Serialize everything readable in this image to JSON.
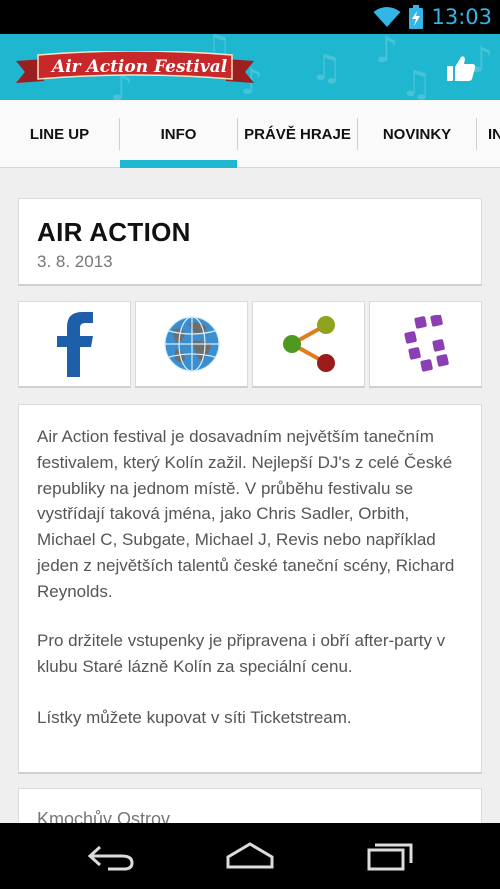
{
  "status_bar": {
    "time": "13:03",
    "icons": [
      "wifi-icon",
      "battery-charging-icon"
    ]
  },
  "app_bar": {
    "logo_text": "Air Action Festival",
    "like_icon": "thumbs-up-icon",
    "background_color": "#1fb6cf",
    "ribbon_color": "#c8282a"
  },
  "tabs": [
    {
      "label": "LINE UP"
    },
    {
      "label": "INFO",
      "selected": true
    },
    {
      "label": "PRÁVĚ HRAJE"
    },
    {
      "label": "NOVINKY"
    },
    {
      "label": "IN"
    }
  ],
  "event": {
    "title": "AIR ACTION",
    "date": "3. 8. 2013"
  },
  "share_buttons": [
    {
      "name": "facebook-icon",
      "color": "#1f5ea8"
    },
    {
      "name": "globe-icon",
      "color": "#3b8fd1"
    },
    {
      "name": "share-icon",
      "colors": [
        "#e07b1e",
        "#4c9a1f",
        "#8fa31e",
        "#9b1b1b"
      ]
    },
    {
      "name": "app-logo-icon",
      "color": "#8a3fb3"
    }
  ],
  "description": {
    "paragraphs": [
      "Air Action festival je dosavadním největším tanečním festivalem, který Kolín zažil. Nejlepší DJ's z celé České republiky na jednom místě. V průběhu festivalu se vystřídají taková jména, jako Chris Sadler, Orbith, Michael C, Subgate, Michael J, Revis nebo například jeden z největších talentů české taneční scény, Richard Reynolds.",
      "Pro držitele vstupenky je připravena i obří after-party v klubu Staré lázně Kolín za speciální cenu.",
      "Lístky můžete kupovat v síti Ticketstream."
    ]
  },
  "next_card": {
    "title": "Kmochův Ostrov"
  },
  "nav_bar": {
    "buttons": [
      "back-icon",
      "home-icon",
      "recents-icon"
    ]
  }
}
